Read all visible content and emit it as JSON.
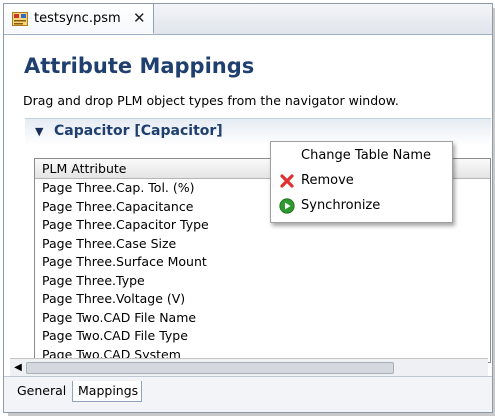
{
  "editor_tab": {
    "label": "testsync.psm",
    "close_glyph": "✕"
  },
  "form": {
    "title": "Attribute Mappings",
    "description": "Drag and drop PLM object types from the navigator window."
  },
  "section": {
    "toggle_glyph": "▼",
    "title": "Capacitor [Capacitor]"
  },
  "table": {
    "column_header": "PLM Attribute",
    "rows": [
      "Page Three.Cap. Tol. (%)",
      "Page Three.Capacitance",
      "Page Three.Capacitor Type",
      "Page Three.Case Size",
      "Page Three.Surface Mount",
      "Page Three.Type",
      "Page Three.Voltage (V)",
      "Page Two.CAD File Name",
      "Page Two.CAD File Type",
      "Page Two.CAD System"
    ]
  },
  "scrollbar": {
    "left_arrow": "◀"
  },
  "page_tabs": {
    "general": "General",
    "mappings": "Mappings"
  },
  "context_menu": {
    "change_table_name": "Change Table Name",
    "remove": "Remove",
    "synchronize": "Synchronize"
  },
  "icons": {
    "file_icon": "psm-file-icon",
    "remove_icon": "red-x-icon",
    "synchronize_icon": "green-play-icon"
  },
  "colors": {
    "title": "#1f3f6e",
    "remove_icon": "#e03030",
    "synchronize_icon": "#2e9a2e"
  }
}
